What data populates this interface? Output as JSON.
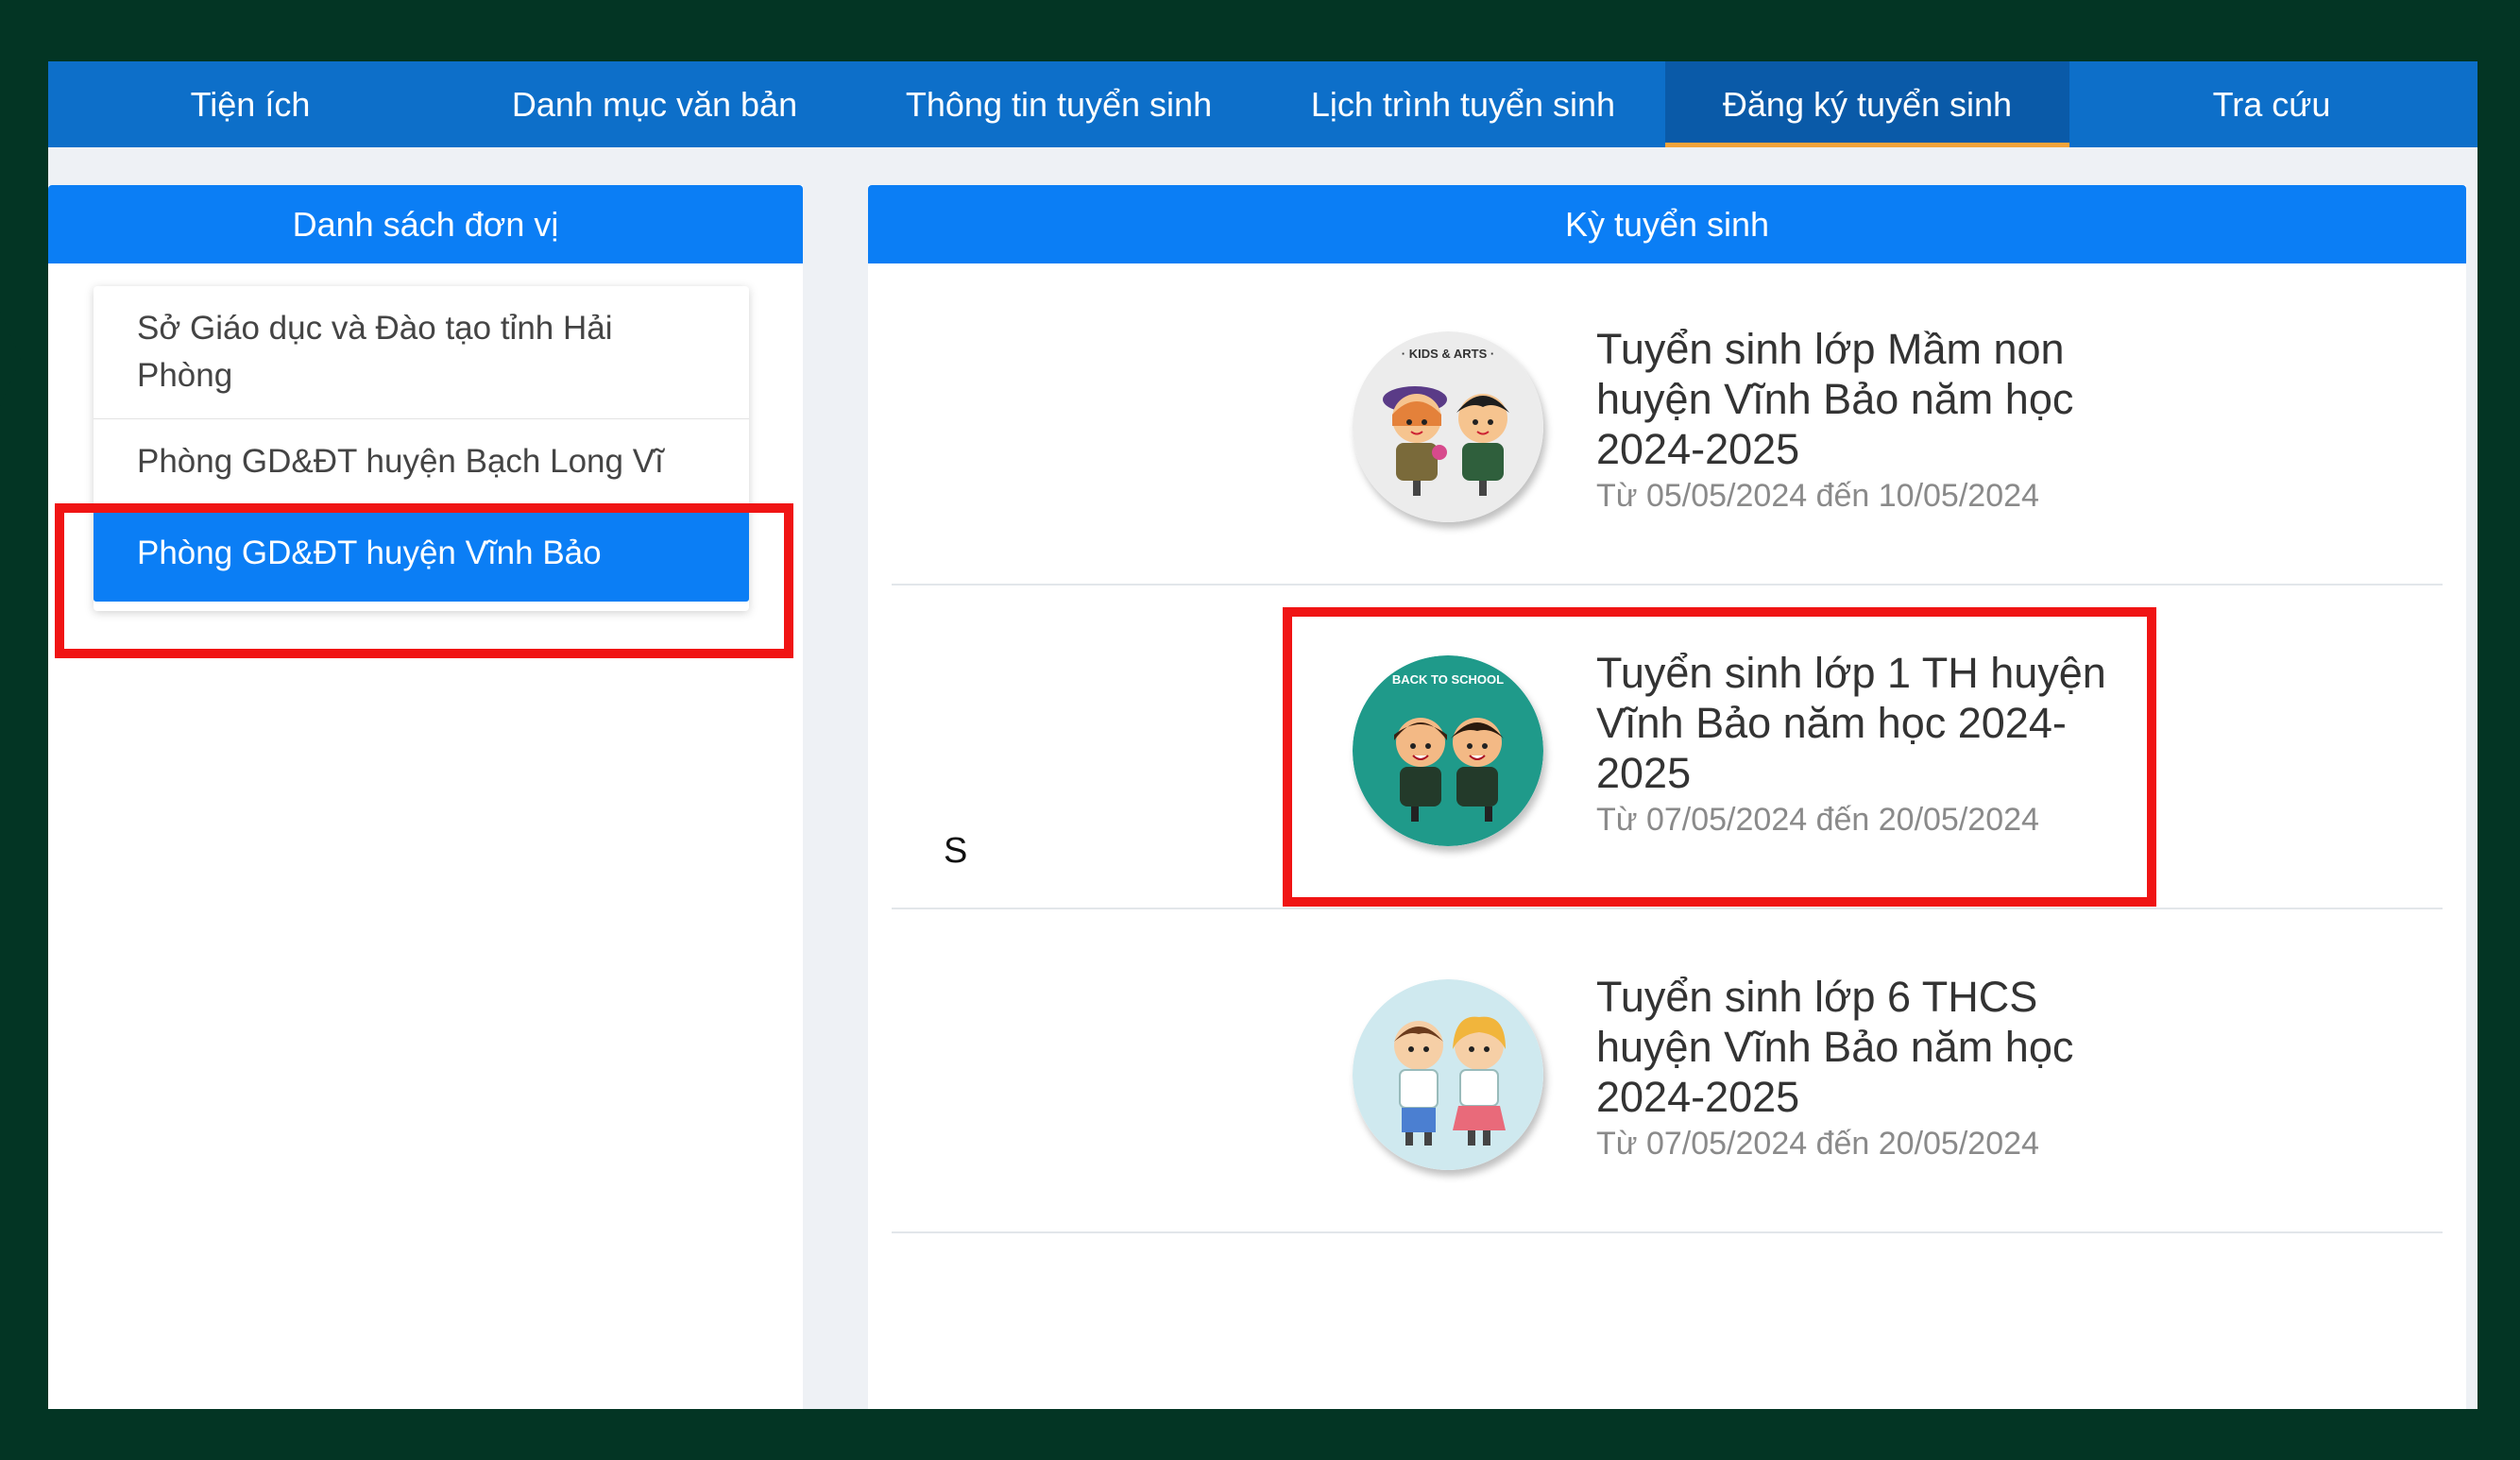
{
  "nav": {
    "tabs": [
      {
        "label": "Tiện ích"
      },
      {
        "label": "Danh mục văn bản"
      },
      {
        "label": "Thông tin tuyển sinh"
      },
      {
        "label": "Lịch trình tuyển sinh"
      },
      {
        "label": "Đăng ký tuyển sinh",
        "active": true
      },
      {
        "label": "Tra cứu"
      }
    ]
  },
  "left_panel": {
    "header": "Danh sách đơn vị",
    "units": [
      {
        "label": "Sở Giáo dục và Đào tạo tỉnh Hải Phòng"
      },
      {
        "label": "Phòng GD&ĐT huyện Bạch Long Vĩ"
      },
      {
        "label": "Phòng GD&ĐT huyện Vĩnh Bảo",
        "active": true
      }
    ]
  },
  "right_panel": {
    "header": "Kỳ tuyển sinh",
    "stray_text": "S",
    "periods": [
      {
        "title": "Tuyển sinh lớp Mầm non huyện Vĩnh Bảo năm học 2024-2025",
        "dates": "Từ 05/05/2024 đến 10/05/2024",
        "badge": "· KIDS & ARTS ·"
      },
      {
        "title": "Tuyển sinh lớp 1 TH huyện Vĩnh Bảo năm học 2024-2025",
        "dates": "Từ 07/05/2024 đến 20/05/2024",
        "badge": "BACK TO SCHOOL"
      },
      {
        "title": "Tuyển sinh lớp 6 THCS huyện Vĩnh Bảo năm học 2024-2025",
        "dates": "Từ 07/05/2024 đến 20/05/2024",
        "badge": ""
      }
    ]
  },
  "colors": {
    "frame": "#033524",
    "nav": "#0d6fc9",
    "accent": "#0b7ef5",
    "highlight": "#f01414",
    "tab_underline": "#f2a33a"
  }
}
